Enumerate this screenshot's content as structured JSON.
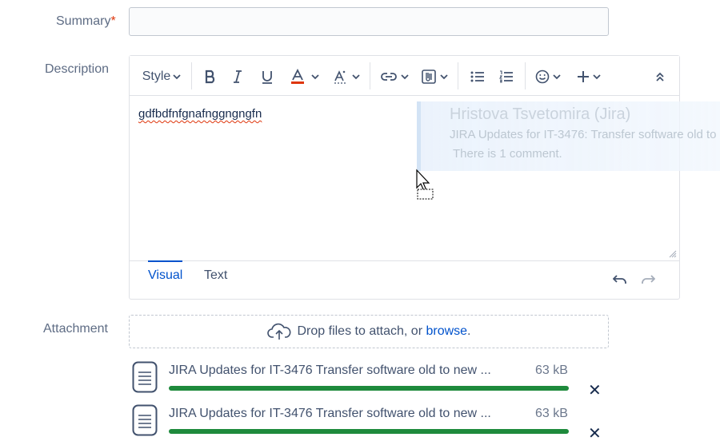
{
  "summary": {
    "label": "Summary",
    "required_mark": "*",
    "value": ""
  },
  "description": {
    "label": "Description",
    "toolbar": {
      "style_label": "Style"
    },
    "content": "gdfbdfnfgnafnggngngfn",
    "tabs": [
      {
        "label": "Visual"
      },
      {
        "label": "Text"
      }
    ]
  },
  "notification": {
    "title": "Hristova Tsvetomira (Jira)",
    "line1": "JIRA Updates for IT-3476: Transfer software old to",
    "line2": "There is 1 comment."
  },
  "attachment": {
    "label": "Attachment",
    "drop_text": "Drop files to attach, or ",
    "browse_link": "browse",
    "drop_suffix": ".",
    "files": [
      {
        "name": "JIRA Updates for IT-3476 Transfer software old to new ...",
        "size": "63 kB",
        "progress": 1.0,
        "remove_icon": "✕"
      },
      {
        "name": "JIRA Updates for IT-3476 Transfer software old to new ...",
        "size": "63 kB",
        "progress": 1.0,
        "remove_icon": "✕"
      }
    ]
  },
  "icons": {
    "bold": "bold-icon",
    "italic": "italic-icon",
    "underline": "underline-icon",
    "text_color": "text-color-icon",
    "text_style": "text-style-icon",
    "link": "link-icon",
    "attachment": "attachment-icon",
    "bullet_list": "bullet-list-icon",
    "numbered_list": "numbered-list-icon",
    "emoji": "emoji-icon",
    "insert": "plus-icon",
    "collapse": "collapse-icon",
    "undo": "undo-icon",
    "redo": "redo-icon",
    "cloud": "cloud-upload-icon",
    "file": "file-icon"
  },
  "colors": {
    "accent": "#0052cc",
    "progress": "#1e8a3c",
    "required": "#de350b",
    "text_color_bar": "#de350b"
  }
}
